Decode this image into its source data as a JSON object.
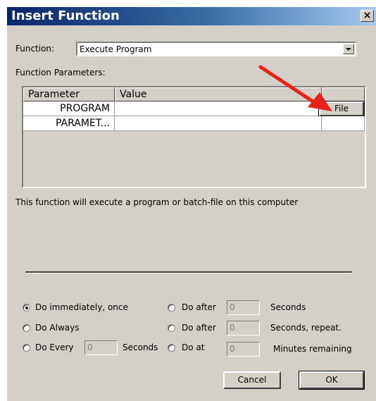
{
  "window": {
    "title": "Insert Function",
    "close_label": "×"
  },
  "function_label": "Function:",
  "function_value": "Execute Program",
  "params_label": "Function Parameters:",
  "grid": {
    "headers": [
      "Parameter",
      "Value"
    ],
    "rows": [
      {
        "name": "PROGRAM",
        "value": ""
      },
      {
        "name": "PARAMET...",
        "value": ""
      }
    ],
    "file_button": "File"
  },
  "description": "This function will execute a program or batch-file on this computer",
  "options": {
    "do_immediately": "Do immediately, once",
    "do_always": "Do Always",
    "do_every": "Do Every",
    "do_every_value": "0",
    "do_every_unit": "Seconds",
    "do_after_1": "Do after",
    "do_after_1_value": "0",
    "do_after_1_unit": "Seconds",
    "do_after_2": "Do after",
    "do_after_2_value": "0",
    "do_after_2_unit": "Seconds, repeat.",
    "do_at": "Do at",
    "do_at_value": "0",
    "do_at_unit": "Minutes remaining",
    "selected": "do_immediately"
  },
  "buttons": {
    "cancel": "Cancel",
    "ok": "OK"
  },
  "colors": {
    "annotation_arrow": "#e8221b",
    "titlebar_start": "#0a246a",
    "titlebar_end": "#a6caf0"
  }
}
